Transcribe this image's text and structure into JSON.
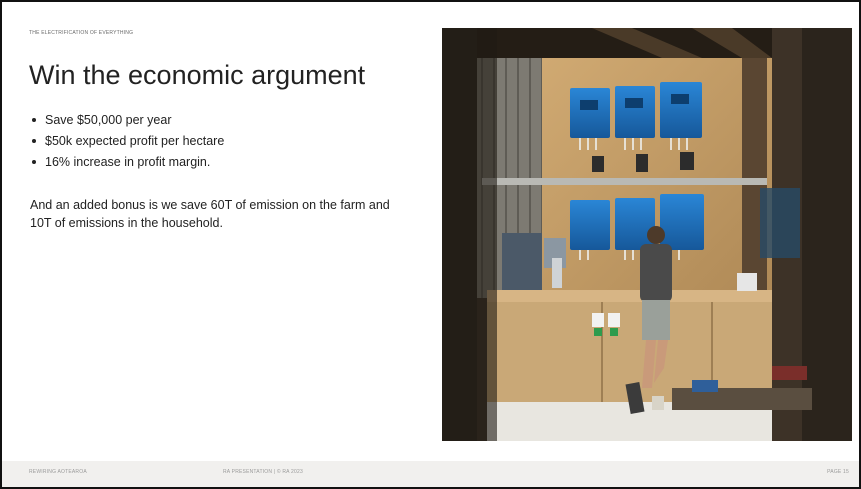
{
  "slide": {
    "eyebrow": "THE ELECTRIFICATION OF EVERYTHING",
    "title": "Win the economic argument",
    "bullets": [
      "Save $50,000 per year",
      "$50k expected profit per hectare",
      "16% increase in profit margin."
    ],
    "body": "And an added bonus is we save 60T of emission on the farm and 10T of emissions in the household."
  },
  "footer": {
    "left": "REWIRING AOTEAROA",
    "center": "RA PRESENTATION  |  © RA 2023",
    "right": "PAGE 15"
  },
  "photo": {
    "subject": "photo-inverters-shed",
    "colors": {
      "inverter_blue": "#1f6fb8",
      "plywood": "#c9a877",
      "shadow": "#2a241c"
    }
  }
}
